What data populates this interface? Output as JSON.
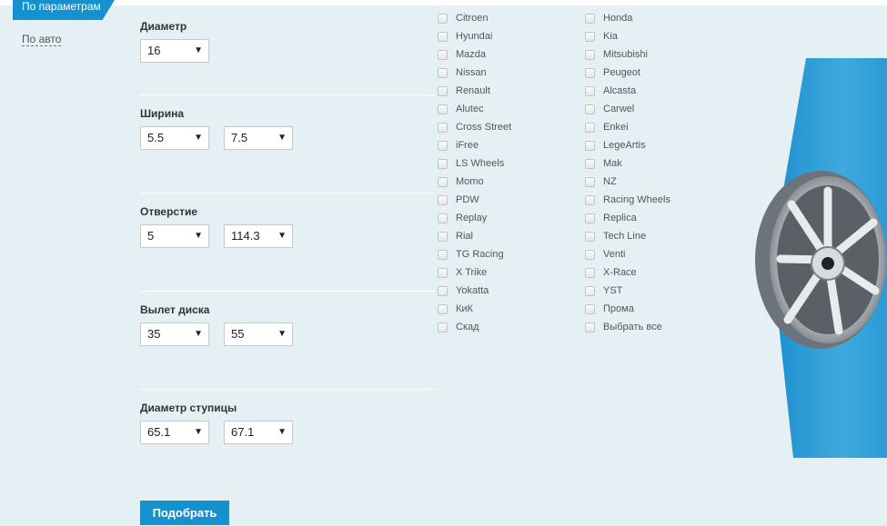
{
  "tabs": {
    "active_label": "По параметрам",
    "link_label": "По авто"
  },
  "filters": [
    {
      "label": "Диаметр",
      "selects": [
        "16"
      ]
    },
    {
      "label": "Ширина",
      "selects": [
        "5.5",
        "7.5"
      ]
    },
    {
      "label": "Отверстие",
      "selects": [
        "5",
        "114.3"
      ]
    },
    {
      "label": "Вылет диска",
      "selects": [
        "35",
        "55"
      ]
    },
    {
      "label": "Диаметр ступицы",
      "selects": [
        "65.1",
        "67.1"
      ]
    }
  ],
  "brands_col1": [
    "Citroen",
    "Hyundai",
    "Mazda",
    "Nissan",
    "Renault",
    "Alutec",
    "Cross Street",
    "iFree",
    "LS Wheels",
    "Momo",
    "PDW",
    "Replay",
    "Rial",
    "TG Racing",
    "X Trike",
    "Yokatta",
    "КиК",
    "Скад"
  ],
  "brands_col2": [
    "Honda",
    "Kia",
    "Mitsubishi",
    "Peugeot",
    "Alcasta",
    "Carwel",
    "Enkei",
    "LegeArtis",
    "Mak",
    "NZ",
    "Racing Wheels",
    "Replica",
    "Tech Line",
    "Venti",
    "X-Race",
    "YST",
    "Прома",
    "Выбрать все"
  ],
  "submit_label": "Подобрать",
  "colors": {
    "accent": "#1591cf",
    "background": "#e5f0f4"
  }
}
